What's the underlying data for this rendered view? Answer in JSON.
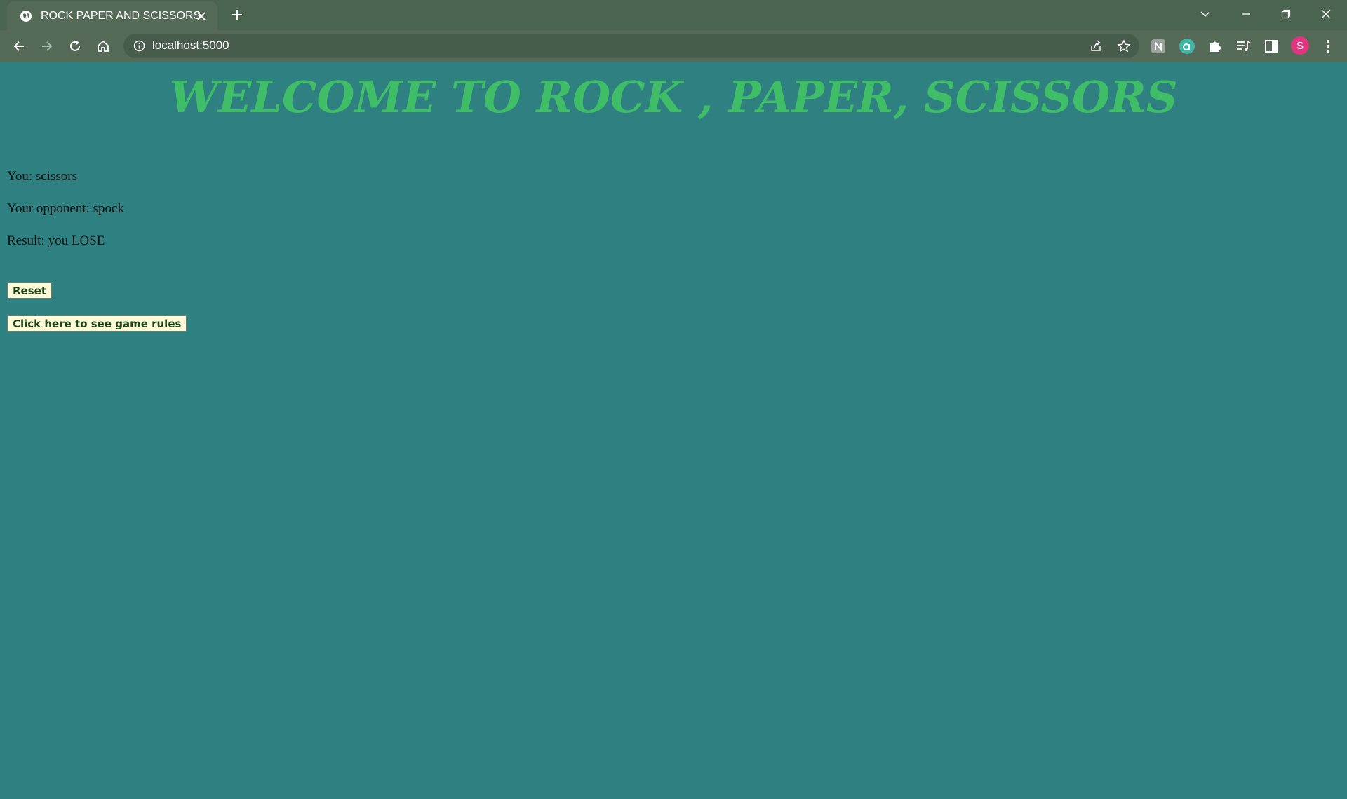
{
  "browser": {
    "tab_title": "ROCK PAPER AND SCISSORS",
    "url": "localhost:5000",
    "avatar_letter": "S"
  },
  "page": {
    "title": "WELCOME TO ROCK , PAPER, SCISSORS",
    "lines": [
      "You: scissors",
      "Your opponent: spock",
      "Result: you LOSE"
    ],
    "reset_label": "Reset",
    "rules_label": "Click here to see game rules"
  },
  "colors": {
    "background": "#2f8080",
    "title": "#3fbd67",
    "button_bg": "#fffbd8"
  }
}
